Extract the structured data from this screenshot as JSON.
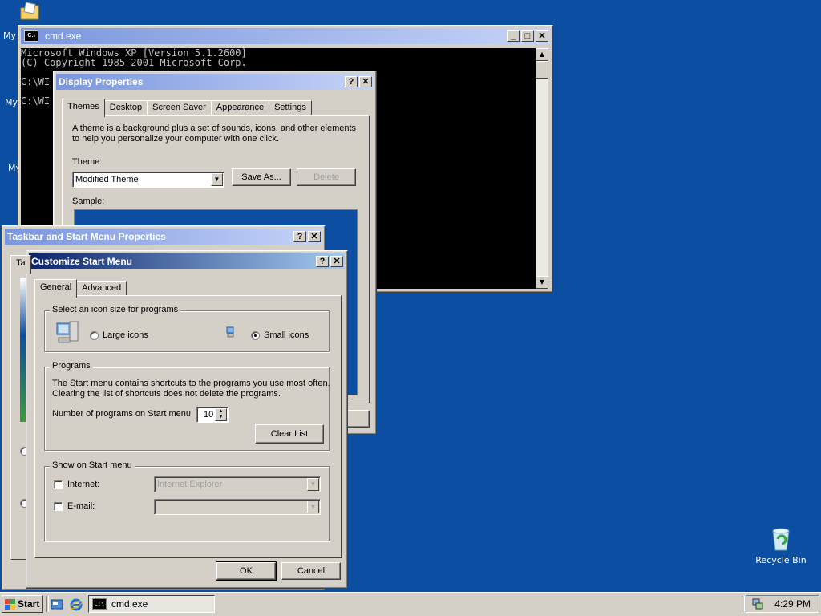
{
  "desktop": {
    "icon_labels": [
      "My",
      "My",
      "My"
    ],
    "recycle_bin_label": "Recycle Bin",
    "background_color": "#0b4ea2"
  },
  "cmd": {
    "title": "cmd.exe",
    "lines": [
      "Microsoft Windows XP [Version 5.1.2600]",
      "(C) Copyright 1985-2001 Microsoft Corp.",
      "",
      "C:\\WI",
      "",
      "C:\\WI"
    ]
  },
  "display_props": {
    "title": "Display Properties",
    "tabs": [
      "Themes",
      "Desktop",
      "Screen Saver",
      "Appearance",
      "Settings"
    ],
    "description": "A theme is a background plus a set of sounds, icons, and other elements to help you personalize your computer with one click.",
    "description_line1": "A theme is a background plus a set of sounds, icons, and other elements",
    "description_line2": "to help you personalize your computer with one click.",
    "theme_label": "Theme:",
    "theme_value": "Modified Theme",
    "save_as_label": "Save As...",
    "delete_label": "Delete",
    "sample_label": "Sample:"
  },
  "taskbar_props": {
    "title": "Taskbar and Start Menu Properties",
    "tab_fragment": "Ta"
  },
  "customize": {
    "title": "Customize Start Menu",
    "tabs": [
      "General",
      "Advanced"
    ],
    "icon_size_group": "Select an icon size for programs",
    "large_icons_label": "Large icons",
    "small_icons_label": "Small icons",
    "programs_group": "Programs",
    "programs_text_line1": "The Start menu contains shortcuts to the programs you use most often.",
    "programs_text_line2": "Clearing the list of shortcuts does not delete the programs.",
    "num_programs_label": "Number of programs on Start menu:",
    "num_programs_value": "10",
    "clear_list_label": "Clear List",
    "show_group": "Show on Start menu",
    "internet_label": "Internet:",
    "internet_value": "Internet Explorer",
    "email_label": "E-mail:",
    "email_value": "",
    "ok_label": "OK",
    "cancel_label": "Cancel"
  },
  "taskbar": {
    "start_label": "Start",
    "task_label": "cmd.exe",
    "clock": "4:29 PM"
  },
  "icons": {
    "title_help": "?",
    "title_close": "✕",
    "title_min": "_",
    "title_max": "□"
  }
}
